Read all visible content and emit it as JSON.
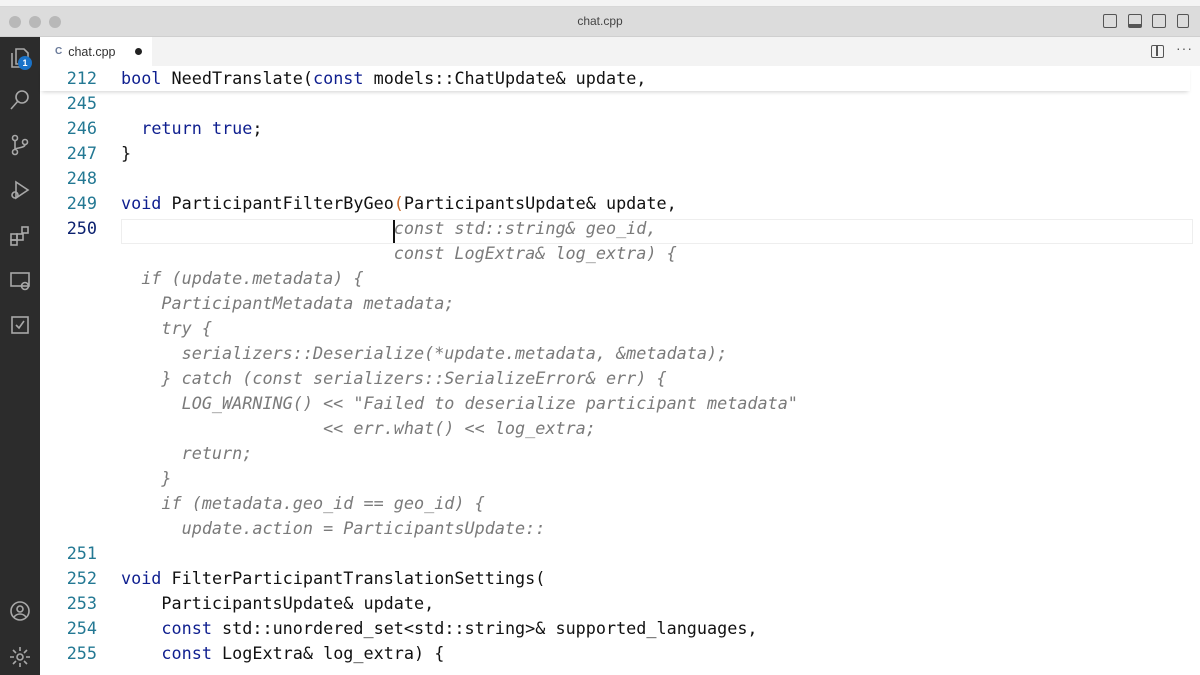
{
  "window": {
    "title": "chat.cpp"
  },
  "activity_bar": {
    "explorer_badge": "1"
  },
  "tab": {
    "label": "chat.cpp",
    "icon_letter": "C"
  },
  "colors": {
    "keyword": "#0f1f8f",
    "line_number": "#237893",
    "ghost": "#7a7a7a",
    "activity_bg": "#2c2c2c"
  },
  "code_lines": [
    {
      "num": "212",
      "sticky": true,
      "segs": [
        [
          "kw",
          "bool"
        ],
        [
          "tx",
          " NeedTranslate("
        ],
        [
          "kw",
          "const"
        ],
        [
          "tx",
          " models::ChatUpdate& update,"
        ]
      ]
    },
    {
      "num": "245",
      "segs": []
    },
    {
      "num": "246",
      "segs": [
        [
          "tx",
          "  "
        ],
        [
          "kw",
          "return"
        ],
        [
          "tx",
          " "
        ],
        [
          "kw",
          "true"
        ],
        [
          "tx",
          ";"
        ]
      ]
    },
    {
      "num": "247",
      "segs": [
        [
          "tx",
          "}"
        ]
      ]
    },
    {
      "num": "248",
      "segs": []
    },
    {
      "num": "249",
      "segs": [
        [
          "kw",
          "void"
        ],
        [
          "tx",
          " ParticipantFilterByGeo"
        ],
        [
          "pn",
          "("
        ],
        [
          "tx",
          "ParticipantsUpdate& update,"
        ]
      ]
    },
    {
      "num": "250",
      "current": true,
      "segs": [
        [
          "tx",
          "                           "
        ],
        [
          "gh",
          "const std::string& geo_id,"
        ]
      ]
    },
    {
      "num": "",
      "segs": [
        [
          "tx",
          "                           "
        ],
        [
          "gh",
          "const LogExtra& log_extra) {"
        ]
      ]
    },
    {
      "num": "",
      "segs": [
        [
          "gh",
          "  if (update.metadata) {"
        ]
      ]
    },
    {
      "num": "",
      "segs": [
        [
          "gh",
          "    ParticipantMetadata metadata;"
        ]
      ]
    },
    {
      "num": "",
      "segs": [
        [
          "gh",
          "    try {"
        ]
      ]
    },
    {
      "num": "",
      "segs": [
        [
          "gh",
          "      serializers::Deserialize(*update.metadata, &metadata);"
        ]
      ]
    },
    {
      "num": "",
      "segs": [
        [
          "gh",
          "    } catch (const serializers::SerializeError& err) {"
        ]
      ]
    },
    {
      "num": "",
      "segs": [
        [
          "gh",
          "      LOG_WARNING() << \"Failed to deserialize participant metadata\""
        ]
      ]
    },
    {
      "num": "",
      "segs": [
        [
          "gh",
          "                    << err.what() << log_extra;"
        ]
      ]
    },
    {
      "num": "",
      "segs": [
        [
          "gh",
          "      return;"
        ]
      ]
    },
    {
      "num": "",
      "segs": [
        [
          "gh",
          "    }"
        ]
      ]
    },
    {
      "num": "",
      "segs": [
        [
          "gh",
          "    if (metadata.geo_id == geo_id) {"
        ]
      ]
    },
    {
      "num": "",
      "segs": [
        [
          "gh",
          "      update.action = ParticipantsUpdate::"
        ]
      ]
    },
    {
      "num": "251",
      "segs": []
    },
    {
      "num": "252",
      "segs": [
        [
          "kw",
          "void"
        ],
        [
          "tx",
          " FilterParticipantTranslationSettings("
        ]
      ]
    },
    {
      "num": "253",
      "segs": [
        [
          "tx",
          "    ParticipantsUpdate& update,"
        ]
      ]
    },
    {
      "num": "254",
      "segs": [
        [
          "tx",
          "    "
        ],
        [
          "kw",
          "const"
        ],
        [
          "tx",
          " std::unordered_set<std::string>& supported_languages,"
        ]
      ]
    },
    {
      "num": "255",
      "segs": [
        [
          "tx",
          "    "
        ],
        [
          "kw",
          "const"
        ],
        [
          "tx",
          " LogExtra& log_extra) {"
        ]
      ]
    }
  ]
}
